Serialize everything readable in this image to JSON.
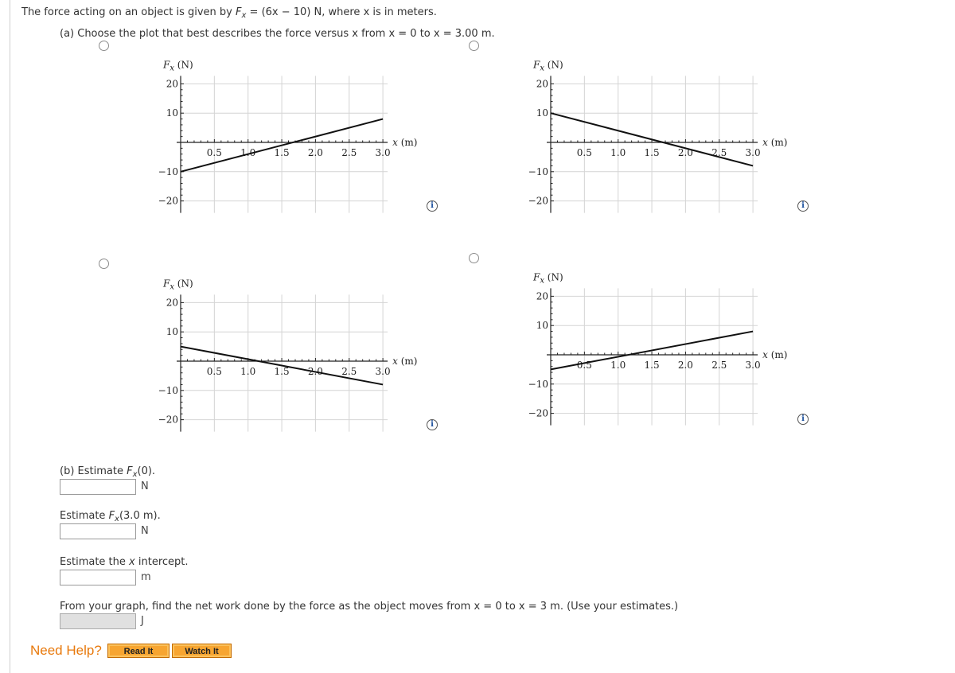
{
  "question": {
    "intro_pre": "The force acting on an object is given by ",
    "intro_F": "F",
    "intro_sub": "x",
    "intro_post": " = (6x − 10) N, where x is in meters.",
    "part_a": "(a) Choose the plot that best describes the force versus x from x = 0 to x = 3.00 m."
  },
  "plots_common": {
    "y_label_F": "F",
    "y_label_sub": "x",
    "y_label_unit": " (N)",
    "x_label_var": "x",
    "x_label_unit": " (m)",
    "x_ticks": [
      "0.5",
      "1.0",
      "1.5",
      "2.0",
      "2.5",
      "3.0"
    ],
    "y_ticks": [
      "20",
      "10",
      "−10",
      "−20"
    ],
    "info_icon": "i"
  },
  "chart_data": [
    {
      "type": "line",
      "option": 1,
      "position": "top-left",
      "xlabel": "x (m)",
      "ylabel": "Fx (N)",
      "xlim": [
        0,
        3.0
      ],
      "ylim": [
        -20,
        20
      ],
      "x_ticks": [
        0.5,
        1.0,
        1.5,
        2.0,
        2.5,
        3.0
      ],
      "y_ticks": [
        -20,
        -10,
        10,
        20
      ],
      "grid": true,
      "series": [
        {
          "name": "Fx",
          "x": [
            0,
            3.0
          ],
          "y": [
            -10,
            8
          ]
        }
      ]
    },
    {
      "type": "line",
      "option": 2,
      "position": "top-right",
      "xlabel": "x (m)",
      "ylabel": "Fx (N)",
      "xlim": [
        0,
        3.0
      ],
      "ylim": [
        -20,
        20
      ],
      "x_ticks": [
        0.5,
        1.0,
        1.5,
        2.0,
        2.5,
        3.0
      ],
      "y_ticks": [
        -20,
        -10,
        10,
        20
      ],
      "grid": true,
      "series": [
        {
          "name": "Fx",
          "x": [
            0,
            3.0
          ],
          "y": [
            10,
            -8
          ]
        }
      ]
    },
    {
      "type": "line",
      "option": 3,
      "position": "bottom-left",
      "xlabel": "x (m)",
      "ylabel": "Fx (N)",
      "xlim": [
        0,
        3.0
      ],
      "ylim": [
        -20,
        20
      ],
      "x_ticks": [
        0.5,
        1.0,
        1.5,
        2.0,
        2.5,
        3.0
      ],
      "y_ticks": [
        -20,
        -10,
        10,
        20
      ],
      "grid": true,
      "series": [
        {
          "name": "Fx",
          "x": [
            0,
            3.0
          ],
          "y": [
            5,
            -8
          ]
        }
      ]
    },
    {
      "type": "line",
      "option": 4,
      "position": "bottom-right",
      "xlabel": "x (m)",
      "ylabel": "Fx (N)",
      "xlim": [
        0,
        3.0
      ],
      "ylim": [
        -20,
        20
      ],
      "x_ticks": [
        0.5,
        1.0,
        1.5,
        2.0,
        2.5,
        3.0
      ],
      "y_ticks": [
        -20,
        -10,
        10,
        20
      ],
      "grid": true,
      "series": [
        {
          "name": "Fx",
          "x": [
            0,
            3.0
          ],
          "y": [
            -5,
            8
          ]
        }
      ]
    }
  ],
  "part_b": {
    "f0_pre": "(b) Estimate ",
    "f0_F": "F",
    "f0_sub": "x",
    "f0_post": "(0).",
    "f0_unit": "N",
    "f0_value": "",
    "f3_pre": "Estimate ",
    "f3_F": "F",
    "f3_sub": "x",
    "f3_post": "(3.0 m).",
    "f3_unit": "N",
    "f3_value": "",
    "xint_pre": "Estimate the ",
    "xint_var": "x",
    "xint_post": " intercept.",
    "xint_unit": "m",
    "xint_value": ""
  },
  "work": {
    "text": "From your graph, find the net work done by the force as the object moves from x = 0 to x = 3 m. (Use your estimates.)",
    "unit": "J",
    "value": ""
  },
  "help": {
    "label": "Need Help?",
    "read_it": "Read It",
    "watch_it": "Watch It"
  },
  "colors": {
    "help_orange": "#e8790c",
    "button_orange": "#f7a531",
    "disabled_input": "#e0e0e0"
  }
}
